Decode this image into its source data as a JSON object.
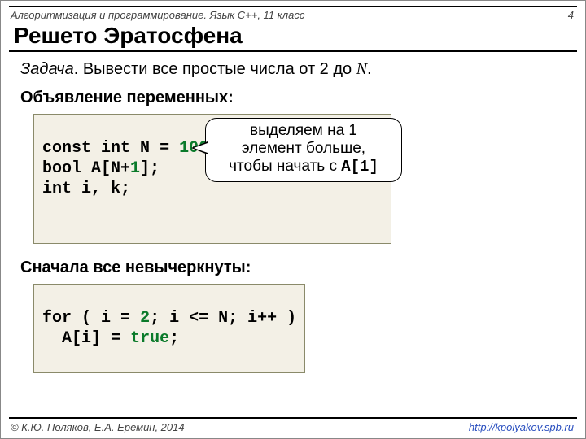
{
  "header": {
    "course": "Алгоритмизация и программирование. Язык C++, 11 класс",
    "page": "4"
  },
  "title": "Решето Эратосфена",
  "task": {
    "label": "Задача",
    "text_before": ". Вывести все простые числа от 2 до ",
    "var": "N",
    "text_after": "."
  },
  "section1": "Объявление переменных",
  "code1": {
    "l1a": "const int",
    "l1b": " N",
    "l1c": "=",
    "l1d": "100",
    "l1e": ";",
    "l2a": "bool",
    "l2b": " A[N+",
    "l2c": "1",
    "l2d": "];",
    "l3a": "int",
    "l3b": " i, k;"
  },
  "callout": {
    "line1": "выделяем на 1",
    "line2": "элемент больше,",
    "line3a": "чтобы начать с ",
    "mono": "A[1]"
  },
  "section2": "Сначала все невычеркнуты",
  "code2": {
    "l1a": "for",
    "l1b": " ( i",
    "l1c": "=",
    "l1d": "2",
    "l1e": "; i",
    "l1f": "<=",
    "l1g": "N; i++ )",
    "l2a": "  A[i]",
    "l2b": "=",
    "l2c": "true",
    "l2d": ";"
  },
  "footer": {
    "copyright": "© К.Ю. Поляков, Е.А. Еремин, 2014",
    "url": "http://kpolyakov.spb.ru"
  }
}
